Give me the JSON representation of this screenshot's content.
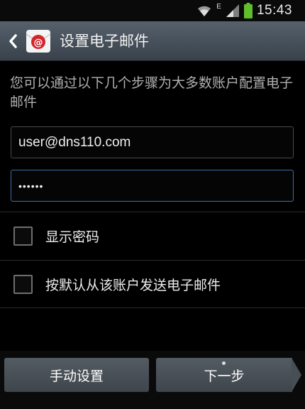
{
  "status_bar": {
    "network_type": "E",
    "time": "15:43",
    "icons": [
      "wifi-icon",
      "signal-icon",
      "battery-icon"
    ]
  },
  "header": {
    "title": "设置电子邮件",
    "back_icon": "chevron-left-icon",
    "app_icon": "email-app-icon"
  },
  "main": {
    "description": "您可以通过以下几个步骤为大多数账户配置电子邮件",
    "email_value": "user@dns110.com",
    "password_value": "••••••",
    "checkboxes": [
      {
        "label": "显示密码",
        "checked": false
      },
      {
        "label": "按默认从该账户发送电子邮件",
        "checked": false
      }
    ]
  },
  "buttons": {
    "manual_setup": "手动设置",
    "next": "下一步"
  },
  "colors": {
    "title_bar": "#4b555e",
    "focus_border": "#3b6fb0",
    "button": "#4a5157"
  }
}
